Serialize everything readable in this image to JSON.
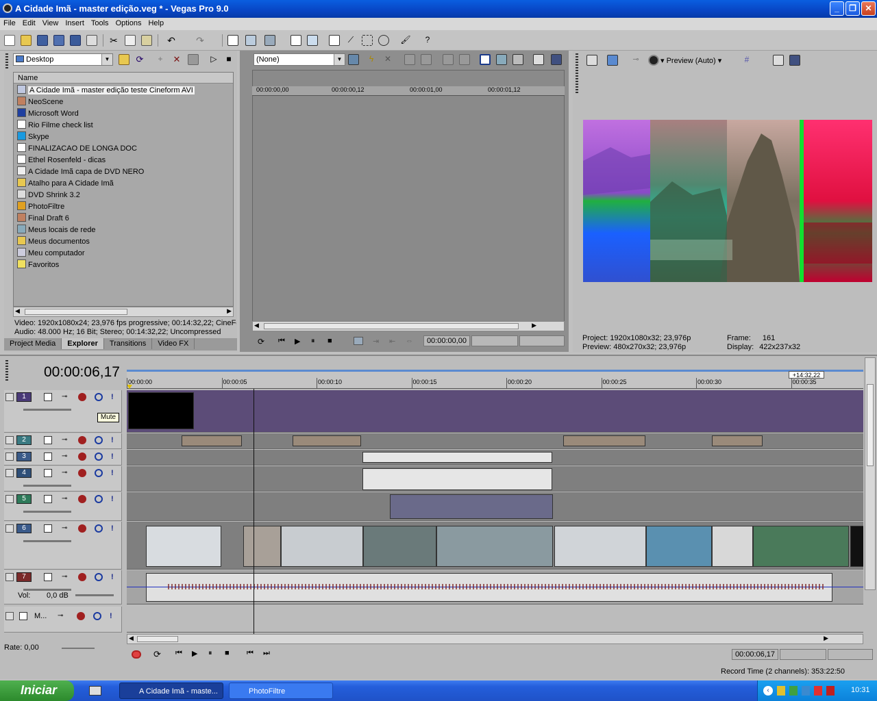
{
  "app": {
    "title": "A Cidade Imã - master edição.veg * - Vegas Pro 9.0"
  },
  "menu": [
    "File",
    "Edit",
    "View",
    "Insert",
    "Tools",
    "Options",
    "Help"
  ],
  "explorer": {
    "location": "Desktop",
    "column_header": "Name",
    "items": [
      {
        "label": "A Cidade Imã - master edição teste Cineform AVI",
        "icon": "video-file-icon",
        "selected": true
      },
      {
        "label": "NeoScene",
        "icon": "app-icon"
      },
      {
        "label": "Microsoft Word",
        "icon": "word-icon"
      },
      {
        "label": "Rio Filme check list",
        "icon": "word-doc-icon"
      },
      {
        "label": "Skype",
        "icon": "skype-icon"
      },
      {
        "label": "FINALIZACAO DE LONGA DOC",
        "icon": "pdf-icon"
      },
      {
        "label": "Ethel Rosenfeld - dicas",
        "icon": "word-doc-icon"
      },
      {
        "label": "A Cidade Imã  capa de DVD NERO",
        "icon": "file-icon"
      },
      {
        "label": "Atalho para A Cidade Imã",
        "icon": "folder-icon"
      },
      {
        "label": "DVD Shrink 3.2",
        "icon": "disc-icon"
      },
      {
        "label": "PhotoFiltre",
        "icon": "photofiltre-icon"
      },
      {
        "label": "Final Draft 6",
        "icon": "app-icon"
      },
      {
        "label": "Meus locais de rede",
        "icon": "network-icon"
      },
      {
        "label": "Meus documentos",
        "icon": "folder-icon"
      },
      {
        "label": "Meu computador",
        "icon": "computer-icon"
      },
      {
        "label": "Favoritos",
        "icon": "star-icon"
      }
    ],
    "info_video": "Video: 1920x1080x24; 23,976 fps progressive; 00:14:32,22; CineFor",
    "info_audio": "Audio: 48.000 Hz; 16 Bit; Stereo; 00:14:32,22; Uncompressed",
    "tabs": [
      "Project Media",
      "Explorer",
      "Transitions",
      "Video FX"
    ],
    "active_tab": "Explorer"
  },
  "trimmer": {
    "preset": "(None)",
    "ruler": [
      "00:00:00,00",
      "00:00:00,12",
      "00:00:01,00",
      "00:00:01,12"
    ],
    "timecode": "00:00:00,00"
  },
  "preview": {
    "quality": "Preview (Auto)",
    "project_label": "Project:",
    "project_value": "1920x1080x32; 23,976p",
    "preview_label": "Preview:",
    "preview_value": "480x270x32; 23,976p",
    "frame_label": "Frame:",
    "frame_value": "161",
    "display_label": "Display:",
    "display_value": "422x237x32"
  },
  "timeline": {
    "current_time": "00:00:06,17",
    "end_marker": "+14:32,22",
    "ruler": [
      "00:00:00",
      "00:00:05",
      "00:00:10",
      "00:00:15",
      "00:00:20",
      "00:00:25",
      "00:00:30",
      "00:00:35"
    ],
    "tracks": [
      {
        "num": "1",
        "color": "#4a3a78"
      },
      {
        "num": "2",
        "color": "#3a7a82"
      },
      {
        "num": "3",
        "color": "#3a5a88"
      },
      {
        "num": "4",
        "color": "#2f4f78"
      },
      {
        "num": "5",
        "color": "#2e7a5a"
      },
      {
        "num": "6",
        "color": "#3a5a8a"
      },
      {
        "num": "7",
        "color": "#7a2a2a"
      }
    ],
    "mute_tooltip": "Mute",
    "audio_vol_label": "Vol:",
    "audio_vol_value": "0,0 dB",
    "master_label": "M...",
    "rate_label": "Rate: 0,00",
    "transport_timecode": "00:00:06,17",
    "record_time": "Record Time (2 channels): 353:22:50"
  },
  "taskbar": {
    "start": "Iniciar",
    "tasks": [
      "A Cidade Imã - maste...",
      "PhotoFiltre"
    ],
    "clock": "10:31"
  }
}
